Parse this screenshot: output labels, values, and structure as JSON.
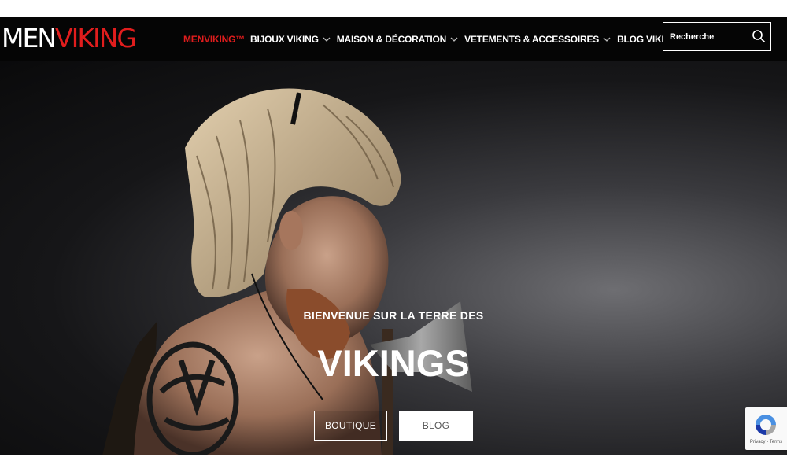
{
  "header": {
    "logo": {
      "part1": "MEN",
      "part2": "VIKING"
    },
    "nav": [
      {
        "label": "MENVIKING™",
        "dropdown": false,
        "active": true
      },
      {
        "label": "BIJOUX VIKING",
        "dropdown": true,
        "active": false
      },
      {
        "label": "MAISON & DÉCORATION",
        "dropdown": true,
        "active": false
      },
      {
        "label": "VETEMENTS & ACCESSOIRES",
        "dropdown": true,
        "active": false
      },
      {
        "label": "BLOG VIKINGS",
        "dropdown": false,
        "active": false
      }
    ],
    "search": {
      "placeholder": "Recherche",
      "icon": "search-icon"
    }
  },
  "hero": {
    "subtitle": "BIENVENUE SUR LA TERRE DES",
    "title": "VIKINGS",
    "buttons": {
      "boutique": "BOUTIQUE",
      "blog": "BLOG"
    },
    "image": "viking-warrior-photo"
  },
  "recaptcha": {
    "text": "Privacy - Terms",
    "icon": "recaptcha-icon"
  },
  "colors": {
    "accent": "#e11d1d",
    "navbar": "#050505",
    "text": "#ffffff"
  }
}
